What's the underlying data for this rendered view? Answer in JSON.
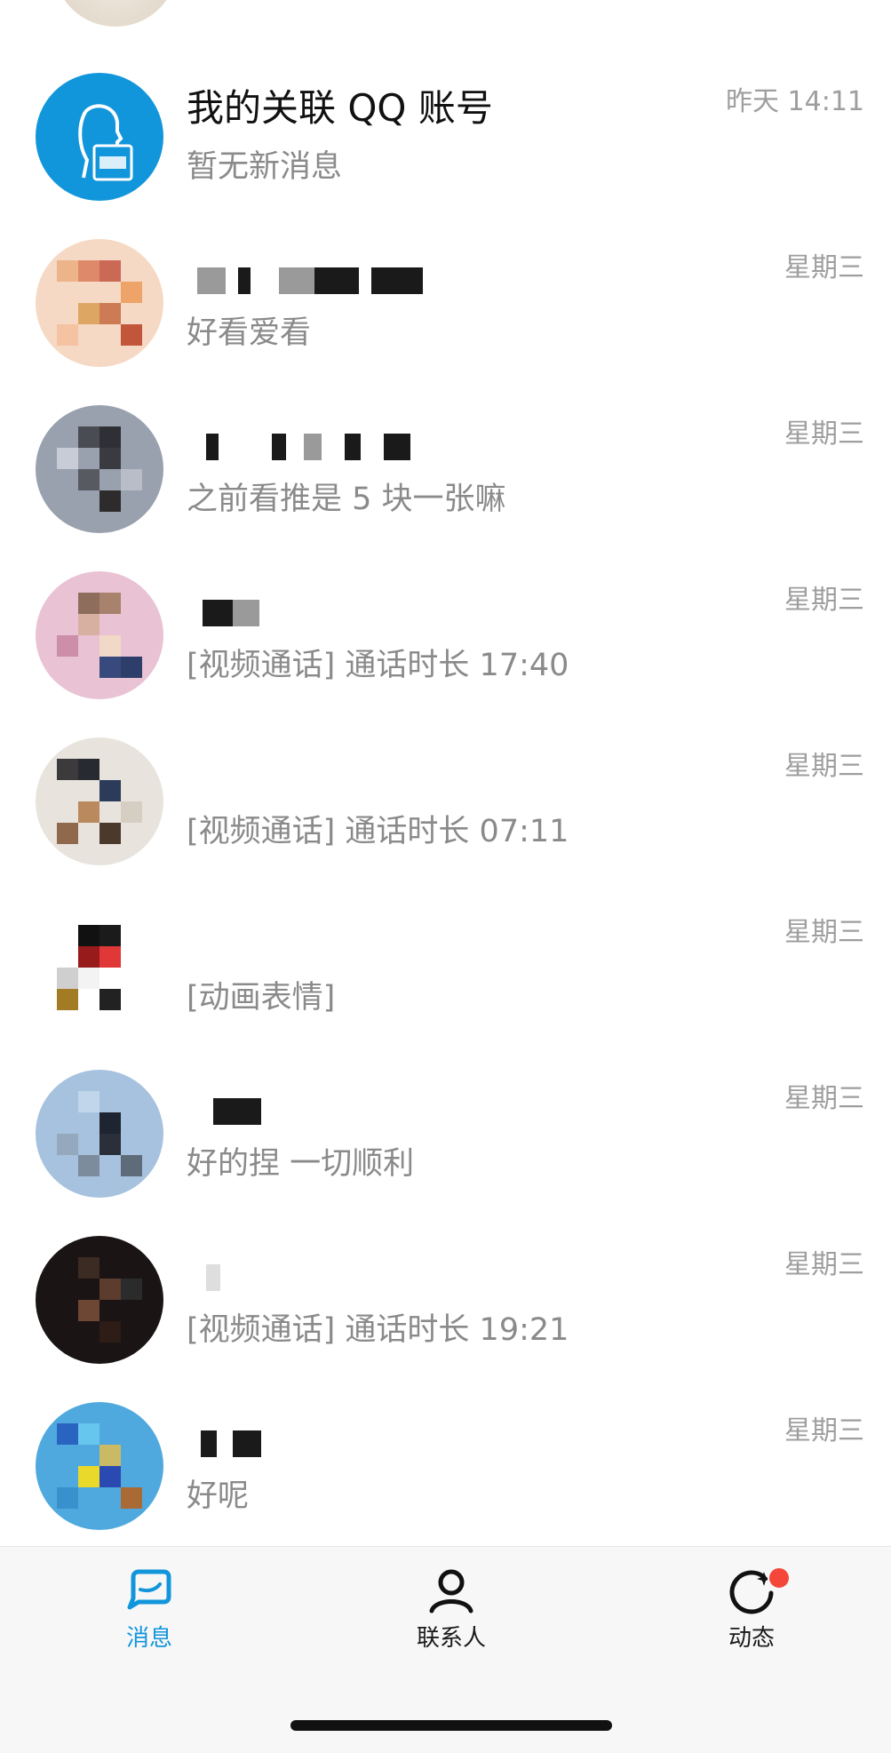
{
  "chats": [
    {
      "name": "我的关联 QQ 账号",
      "preview": "暂无新消息",
      "time": "昨天 14:11"
    },
    {
      "name": "",
      "preview": "好看爱看",
      "time": "星期三"
    },
    {
      "name": "",
      "preview": "之前看推是 5 块一张嘛",
      "time": "星期三"
    },
    {
      "name": "",
      "preview": "[视频通话] 通话时长 17:40",
      "time": "星期三"
    },
    {
      "name": "",
      "preview": "[视频通话] 通话时长 07:11",
      "time": "星期三"
    },
    {
      "name": "",
      "preview": "[动画表情]",
      "time": "星期三"
    },
    {
      "name": "",
      "preview": "好的捏 一切顺利",
      "time": "星期三"
    },
    {
      "name": "",
      "preview": "[视频通话] 通话时长 19:21",
      "time": "星期三"
    },
    {
      "name": "",
      "preview": "好呢",
      "time": "星期三"
    }
  ],
  "tabbar": {
    "messages": {
      "label": "消息",
      "icon": "chat-bubble-icon"
    },
    "contacts": {
      "label": "联系人",
      "icon": "person-icon"
    },
    "moments": {
      "label": "动态",
      "icon": "star-orbit-icon",
      "has_new": true
    }
  },
  "colors": {
    "accent": "#1296db",
    "badge": "#f4473a",
    "preview_text": "#8a8a8a"
  }
}
